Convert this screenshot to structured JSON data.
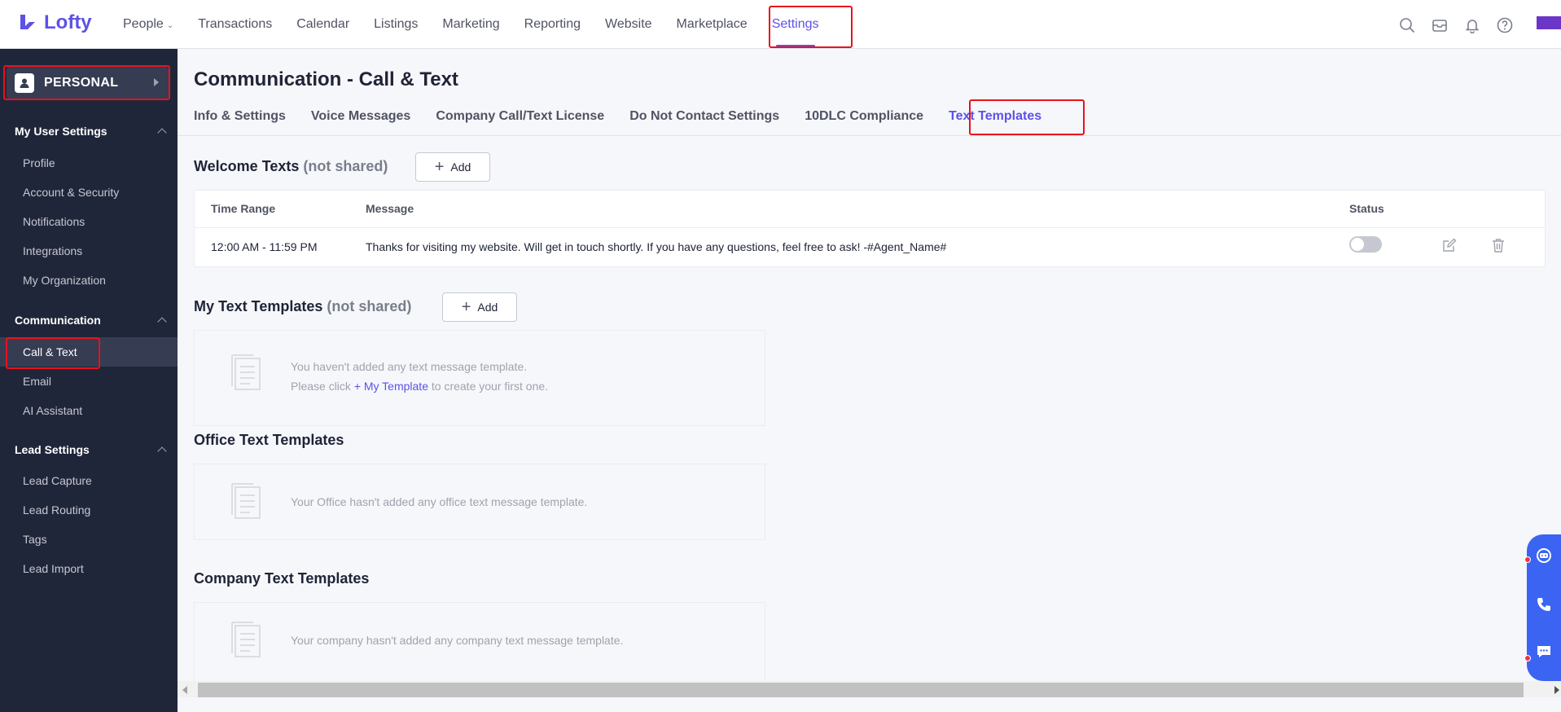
{
  "app": {
    "logo_text": "Lofty",
    "brand_color": "#5d51e8",
    "highlight_color": "#e8121d"
  },
  "topnav": {
    "items": [
      {
        "label": "People",
        "has_dropdown": true
      },
      {
        "label": "Transactions"
      },
      {
        "label": "Calendar"
      },
      {
        "label": "Listings"
      },
      {
        "label": "Marketing"
      },
      {
        "label": "Reporting"
      },
      {
        "label": "Website"
      },
      {
        "label": "Marketplace"
      },
      {
        "label": "Settings",
        "active": true
      }
    ],
    "icons": [
      "search-icon",
      "inbox-icon",
      "bell-icon",
      "help-icon"
    ]
  },
  "sidebar": {
    "persona_label": "PERSONAL",
    "sections": [
      {
        "title": "My User Settings",
        "items": [
          "Profile",
          "Account & Security",
          "Notifications",
          "Integrations",
          "My Organization"
        ]
      },
      {
        "title": "Communication",
        "items": [
          "Call & Text",
          "Email",
          "AI Assistant"
        ],
        "active_item": "Call & Text"
      },
      {
        "title": "Lead Settings",
        "items": [
          "Lead Capture",
          "Lead Routing",
          "Tags",
          "Lead Import"
        ]
      }
    ]
  },
  "main": {
    "title": "Communication - Call & Text",
    "tabs": [
      "Info & Settings",
      "Voice Messages",
      "Company Call/Text License",
      "Do Not Contact Settings",
      "10DLC Compliance",
      "Text Templates"
    ],
    "active_tab": "Text Templates",
    "welcome": {
      "title": "Welcome Texts",
      "suffix": "(not shared)",
      "add_label": "Add",
      "columns": [
        "Time Range",
        "Message",
        "Status"
      ],
      "rows": [
        {
          "time_range": "12:00 AM - 11:59 PM",
          "message": "Thanks for visiting my website. Will get in touch shortly. If you have any questions, feel free to ask! -#Agent_Name#",
          "status_on": false
        }
      ]
    },
    "my_templates": {
      "title": "My Text Templates",
      "suffix": "(not shared)",
      "add_label": "Add",
      "empty_line1": "You haven't added any text message template.",
      "empty_line2_pre": "Please click",
      "empty_link": "+ My Template",
      "empty_line2_post": "to create your first one."
    },
    "office_templates": {
      "title": "Office Text Templates",
      "empty": "Your Office hasn't added any office text message template."
    },
    "company_templates": {
      "title": "Company Text Templates",
      "empty": "Your company hasn't added any company text message template."
    }
  },
  "float_widget": {
    "icons": [
      "chat-bot-icon",
      "phone-icon",
      "message-icon"
    ],
    "color": "#3b64f2"
  }
}
